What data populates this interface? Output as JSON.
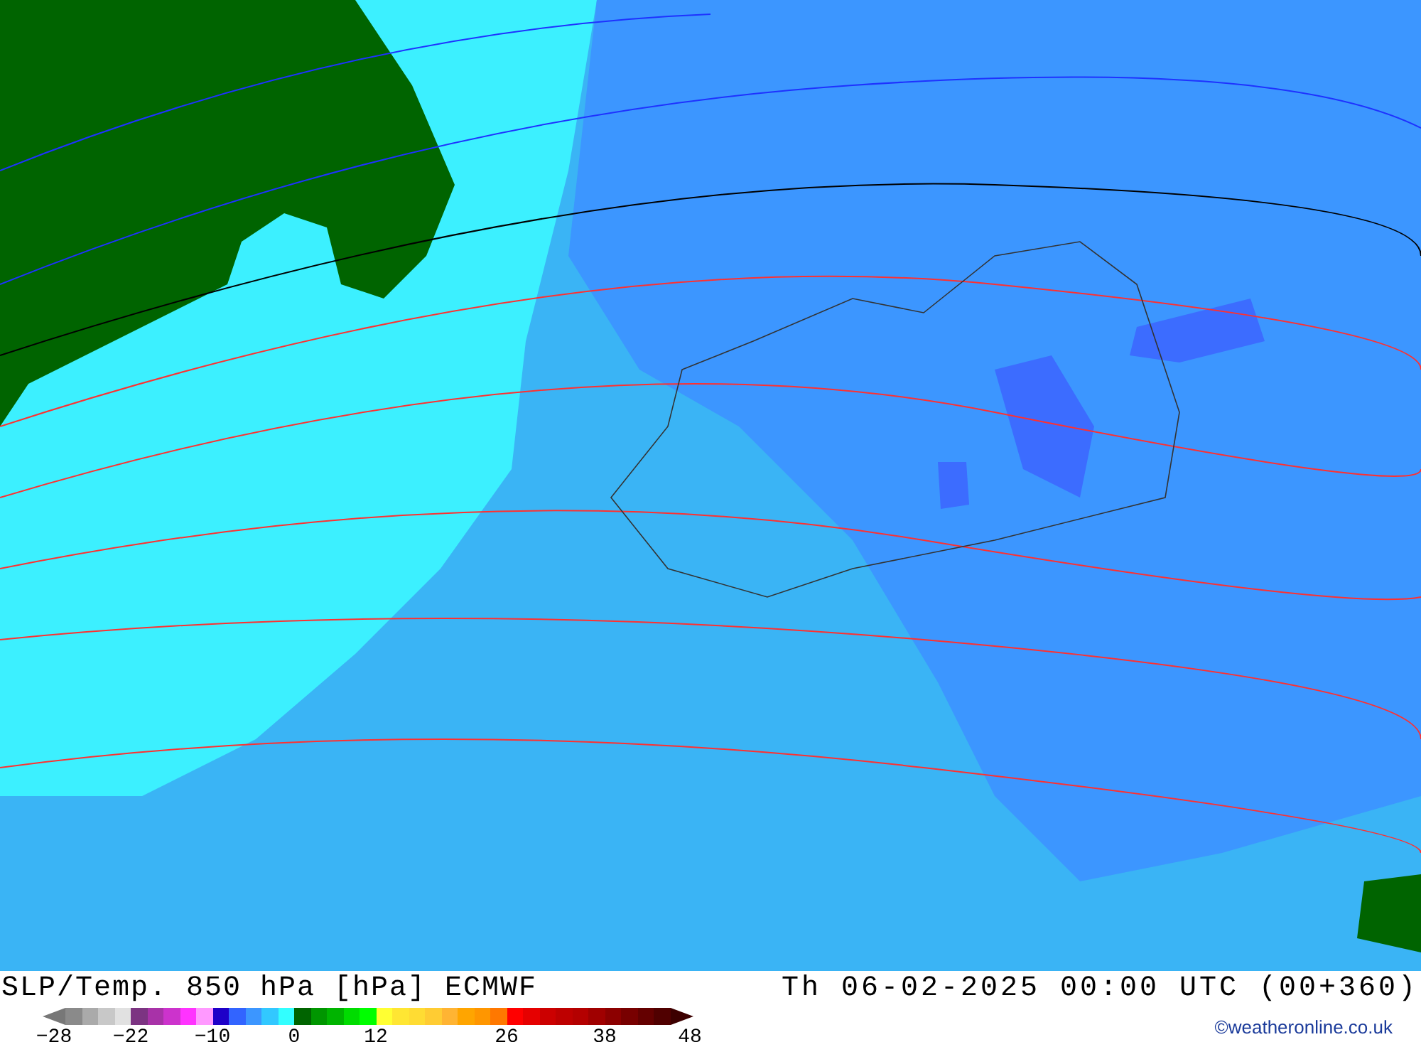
{
  "title": "SLP/Temp. 850 hPa [hPa] ECMWF",
  "valid_time": "Th 06-02-2025 00:00 UTC (00+360)",
  "credit": "©weatheronline.co.uk",
  "legend": {
    "swatches": [
      {
        "kind": "low_arrow",
        "color": "#777777",
        "label": "−28"
      },
      {
        "color": "#8a8a8a"
      },
      {
        "color": "#aaaaaa"
      },
      {
        "color": "#c8c8c8"
      },
      {
        "color": "#e1e1e1"
      },
      {
        "color": "#7c3482",
        "label": "−22"
      },
      {
        "color": "#a832a8"
      },
      {
        "color": "#cc33cc"
      },
      {
        "color": "#ff33ff"
      },
      {
        "color": "#ff99ff"
      },
      {
        "color": "#1e00c8",
        "label": "−10"
      },
      {
        "color": "#3264ff"
      },
      {
        "color": "#3c96ff"
      },
      {
        "color": "#32c8ff"
      },
      {
        "color": "#32ffff"
      },
      {
        "color": "#006400",
        "label": "0"
      },
      {
        "color": "#009600"
      },
      {
        "color": "#00b400"
      },
      {
        "color": "#00dc00"
      },
      {
        "color": "#00ff00"
      },
      {
        "color": "#ffff33",
        "label": "12"
      },
      {
        "color": "#ffe633"
      },
      {
        "color": "#ffdc33"
      },
      {
        "color": "#ffcc33"
      },
      {
        "color": "#ffb433"
      },
      {
        "color": "#ffa500"
      },
      {
        "color": "#ff9600"
      },
      {
        "color": "#ff7800"
      },
      {
        "color": "#ff0000",
        "label": "26"
      },
      {
        "color": "#e60000"
      },
      {
        "color": "#cc0000"
      },
      {
        "color": "#be0000"
      },
      {
        "color": "#b40000"
      },
      {
        "color": "#a00000"
      },
      {
        "color": "#8c0000",
        "label": "38"
      },
      {
        "color": "#780000"
      },
      {
        "color": "#640000"
      },
      {
        "color": "#500000"
      },
      {
        "kind": "high_arrow",
        "color": "#3c0000",
        "label": "48"
      }
    ]
  }
}
